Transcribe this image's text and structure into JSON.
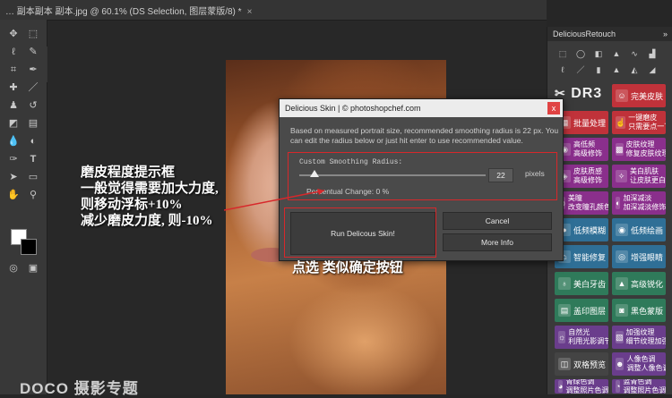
{
  "document_tab": {
    "text": "… 副本副本 副本.jpg @ 60.1% (DS Selection, 图层蒙版/8) *",
    "close": "×"
  },
  "toolbar": {
    "tools": [
      "move-tool",
      "marquee-tool",
      "lasso-tool",
      "quick-selection-tool",
      "crop-tool",
      "eyedropper-tool",
      "healing-brush-tool",
      "brush-tool",
      "clone-stamp-tool",
      "history-brush-tool",
      "eraser-tool",
      "gradient-tool",
      "blur-tool",
      "dodge-tool",
      "pen-tool",
      "type-tool",
      "path-selection-tool",
      "shape-tool",
      "hand-tool",
      "zoom-tool"
    ]
  },
  "retouch_panel": {
    "title": "DeliciousRetouch",
    "collapse": "»",
    "logo": "DR3",
    "buttons": [
      {
        "label": "完美皮肤",
        "color": "#c0323a"
      },
      {
        "label": "批量处理",
        "color": "#c0323a"
      },
      {
        "label": "一键磨皮\n只需要点一下",
        "color": "#c0323a"
      },
      {
        "label": "高低频\n高级修饰",
        "color": "#8a2f8c"
      },
      {
        "label": "皮肤纹理\n修复皮肤纹理",
        "color": "#8a2f8c"
      },
      {
        "label": "皮肤质感\n高级修饰",
        "color": "#8a2f8c"
      },
      {
        "label": "美白肌肤\n让皮肤更白",
        "color": "#8a2f8c"
      },
      {
        "label": "美瞳\n改变瞳孔颜色",
        "color": "#8a2f8c"
      },
      {
        "label": "加深减淡\n加深减淡修饰",
        "color": "#8a2f8c"
      },
      {
        "label": "低频模糊",
        "color": "#2f6f96"
      },
      {
        "label": "低频绘画",
        "color": "#2f6f96"
      },
      {
        "label": "智能修复",
        "color": "#2f6f96"
      },
      {
        "label": "增强眼睛",
        "color": "#2f6f96"
      },
      {
        "label": "美白牙齿",
        "color": "#2f7a5a"
      },
      {
        "label": "高级锐化",
        "color": "#2f7a5a"
      },
      {
        "label": "盖印图层",
        "color": "#2f7a5a"
      },
      {
        "label": "黑色蒙版",
        "color": "#2f7a5a"
      },
      {
        "label": "自然光\n利用光影调节",
        "color": "#6a3d8c"
      },
      {
        "label": "加强纹理\n细节纹理加强",
        "color": "#6a3d8c"
      },
      {
        "label": "双格预览",
        "color": "#444444"
      },
      {
        "label": "人像色调\n调整人像色调",
        "color": "#6a3d8c"
      },
      {
        "label": "青绿色调\n调整照片色调",
        "color": "#6a3d8c"
      },
      {
        "label": "蓝青色调\n调整照片色调",
        "color": "#6a3d8c"
      }
    ]
  },
  "dialog": {
    "title": "Delicious Skin | © photoshopchef.com",
    "close": "x",
    "info": "Based on measured portrait size, recommended smoothing radius is 22 px. You can edit the radius below or just hit enter to use recommended value.",
    "smoothing_label": "Custom Smoothing Radius:",
    "slider_fraction": 0.08,
    "radius_value": "22",
    "unit": "pixels",
    "percent_change": "Percentual Change: 0 %",
    "run_button": "Run Delicous Skin!",
    "cancel_button": "Cancel",
    "more_info_button": "More Info"
  },
  "annotations": {
    "left_lines": [
      "磨皮程度提示框",
      "一般觉得需要加大力度,",
      "则移动浮标+10%",
      "减少磨皮力度, 则-10%"
    ],
    "click_hint": "点选 类似确定按钮"
  },
  "watermark": "DOCO 摄影专题",
  "accent_red": "#d7282b"
}
